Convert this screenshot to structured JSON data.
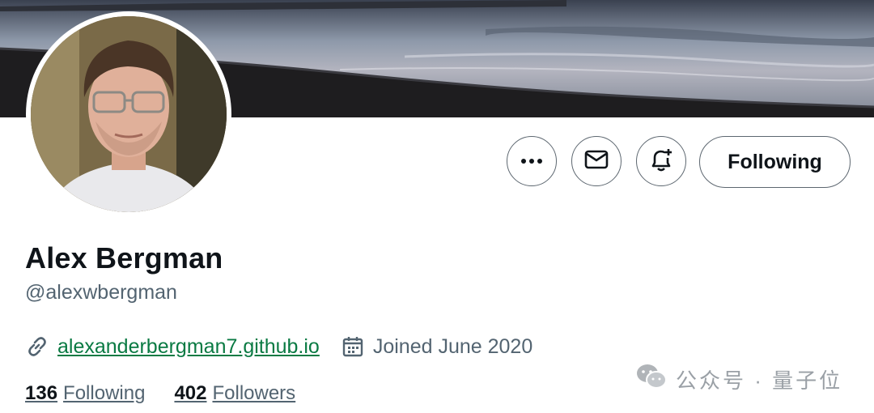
{
  "profile": {
    "name": "Alex Bergman",
    "handle": "@alexwbergman",
    "website": "alexanderbergman7.github.io",
    "joined": "Joined June 2020"
  },
  "actions": {
    "following_label": "Following"
  },
  "stats": {
    "following_count": "136",
    "following_label": "Following",
    "followers_count": "402",
    "followers_label": "Followers"
  },
  "watermark": {
    "text": "公众号 · 量子位"
  },
  "icons": {
    "more": "more-icon",
    "message": "envelope-icon",
    "notify": "bell-plus-icon",
    "link": "link-icon",
    "calendar": "calendar-icon",
    "wechat": "wechat-icon"
  },
  "colors": {
    "text_primary": "#0f1419",
    "text_secondary": "#536471",
    "link": "#0a7a43",
    "border": "#5d6770"
  }
}
